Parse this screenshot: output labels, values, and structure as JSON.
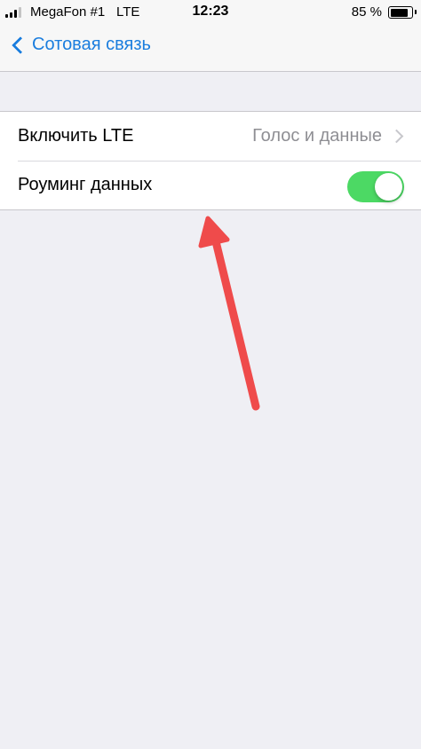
{
  "status_bar": {
    "carrier": "MegaFon #1",
    "network": "LTE",
    "time": "12:23",
    "battery_percent": "85 %",
    "battery_level": 0.85,
    "signal_bars_filled": 3,
    "signal_bars_total": 4
  },
  "nav": {
    "back_label": "Сотовая связь"
  },
  "settings": {
    "rows": [
      {
        "label": "Включить LTE",
        "value": "Голос и данные"
      },
      {
        "label": "Роуминг данных",
        "toggle_on": true
      }
    ]
  },
  "colors": {
    "accent": "#1a7dde",
    "toggle_on": "#4cd964",
    "background": "#efeff4",
    "annotation_arrow": "#ef4b4b"
  }
}
